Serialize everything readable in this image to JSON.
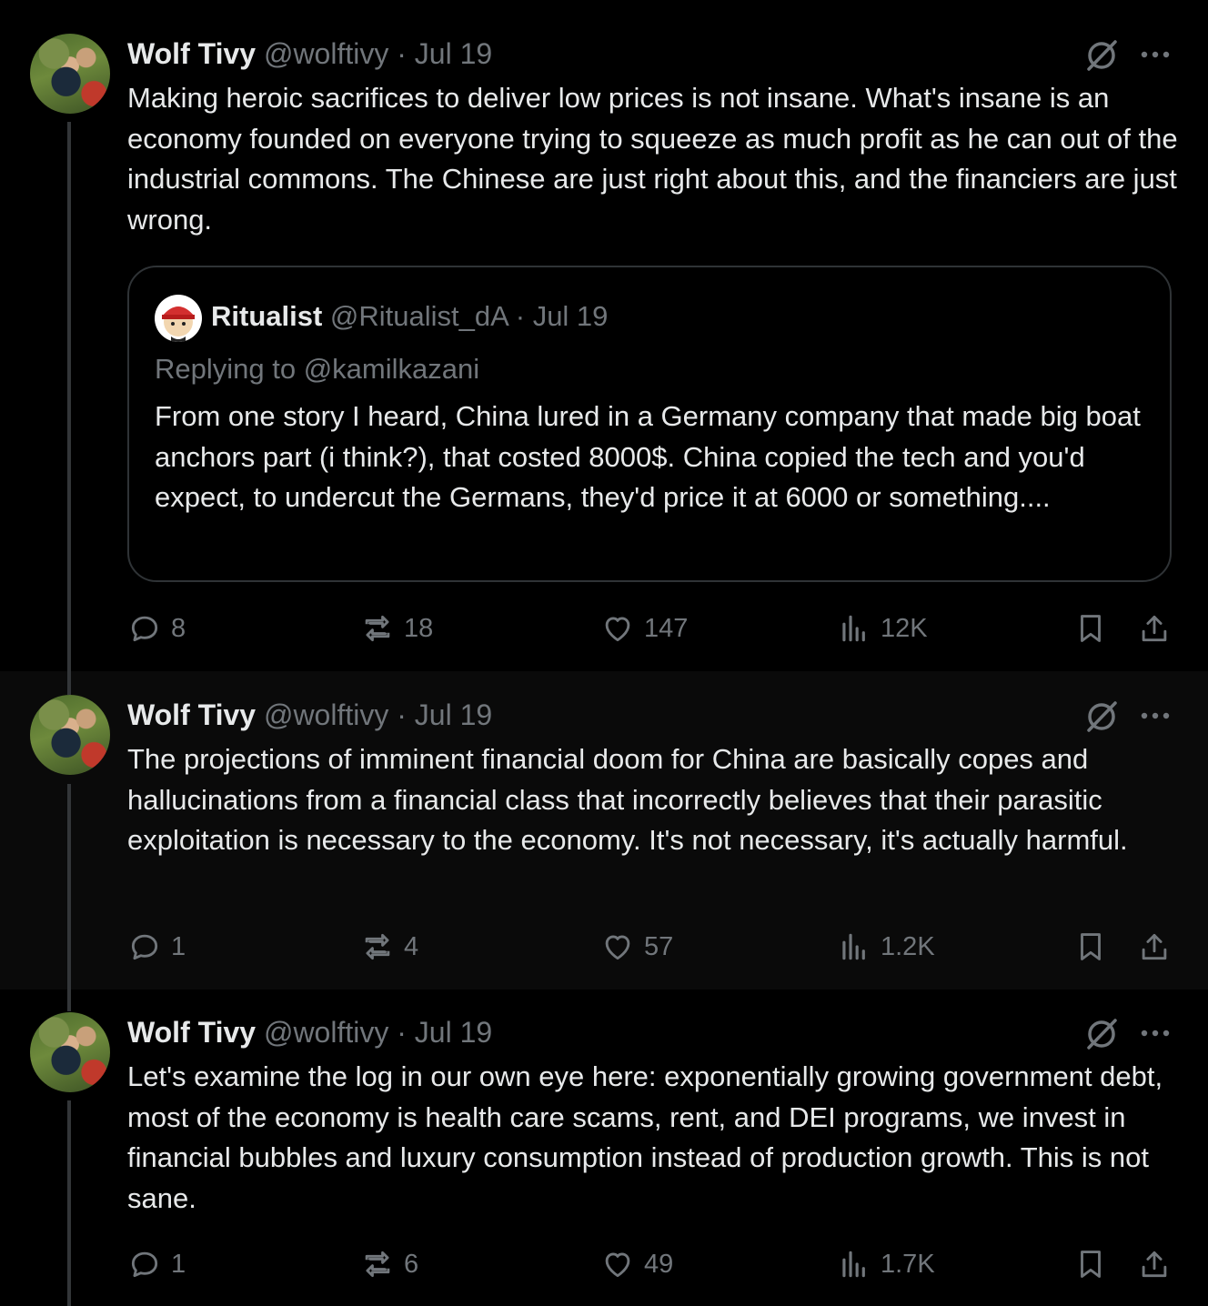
{
  "colors": {
    "background": "#000000",
    "text": "#e7e9ea",
    "secondary": "#71767b",
    "border": "#2f3336"
  },
  "tweets": [
    {
      "author_name": "Wolf Tivy",
      "handle": "@wolftivy",
      "separator": "·",
      "date": "Jul 19",
      "text": "Making heroic sacrifices to deliver low prices is not insane. What's insane is an economy founded on everyone trying to squeeze as much profit as he can out of the industrial commons. The Chinese are just right about this, and the financiers are just wrong.",
      "quote": {
        "author_name": "Ritualist",
        "handle": "@Ritualist_dA",
        "separator": "·",
        "date": "Jul 19",
        "replying_to": "Replying to @kamilkazani",
        "text": "From one story I heard, China lured in a Germany company that made big boat anchors part (i think?), that costed 8000$. China copied the tech and you'd expect, to undercut the Germans, they'd price it at 6000 or something...."
      },
      "replies": "8",
      "reposts": "18",
      "likes": "147",
      "views": "12K"
    },
    {
      "author_name": "Wolf Tivy",
      "handle": "@wolftivy",
      "separator": "·",
      "date": "Jul 19",
      "text": "The projections of imminent financial doom for China are basically copes and hallucinations from a financial class that incorrectly believes that their parasitic exploitation is necessary to the economy. It's not necessary, it's actually harmful.",
      "replies": "1",
      "reposts": "4",
      "likes": "57",
      "views": "1.2K"
    },
    {
      "author_name": "Wolf Tivy",
      "handle": "@wolftivy",
      "separator": "·",
      "date": "Jul 19",
      "text": "Let's examine the log in our own eye here: exponentially growing government debt, most of the economy is health care scams, rent, and DEI programs, we invest in financial bubbles and luxury consumption instead of production growth. This is not sane.",
      "replies": "1",
      "reposts": "6",
      "likes": "49",
      "views": "1.7K"
    }
  ]
}
